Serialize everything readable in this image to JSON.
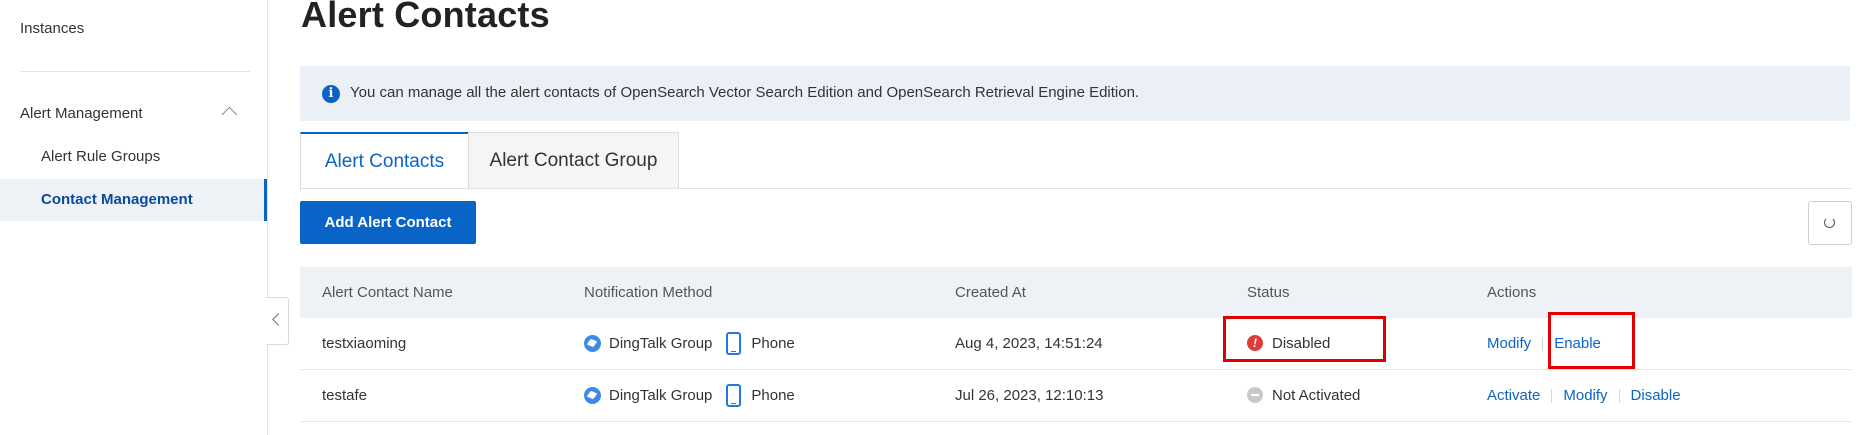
{
  "sidebar": {
    "items": [
      {
        "label": "Instances"
      },
      {
        "label": "Alert Management"
      },
      {
        "label": "Alert Rule Groups"
      },
      {
        "label": "Contact Management"
      }
    ]
  },
  "page": {
    "title": "Alert Contacts",
    "notice": "You can manage all the alert contacts of OpenSearch Vector Search Edition and OpenSearch Retrieval Engine Edition."
  },
  "tabs": [
    {
      "label": "Alert Contacts",
      "active": true
    },
    {
      "label": "Alert Contact Group",
      "active": false
    }
  ],
  "toolbar": {
    "add_label": "Add Alert Contact"
  },
  "table": {
    "headers": [
      "Alert Contact Name",
      "Notification Method",
      "Created At",
      "Status",
      "Actions"
    ],
    "rows": [
      {
        "name": "testxiaoming",
        "methods": [
          "DingTalk Group",
          "Phone"
        ],
        "created_at": "Aug 4, 2023, 14:51:24",
        "status": "Disabled",
        "actions": [
          "Modify",
          "Enable"
        ]
      },
      {
        "name": "testafe",
        "methods": [
          "DingTalk Group",
          "Phone"
        ],
        "created_at": "Jul 26, 2023, 12:10:13",
        "status": "Not Activated",
        "actions": [
          "Activate",
          "Modify",
          "Disable"
        ]
      }
    ]
  },
  "colors": {
    "primary": "#0a64c8",
    "error": "#e03b3b",
    "highlight_box": "#e00000"
  }
}
